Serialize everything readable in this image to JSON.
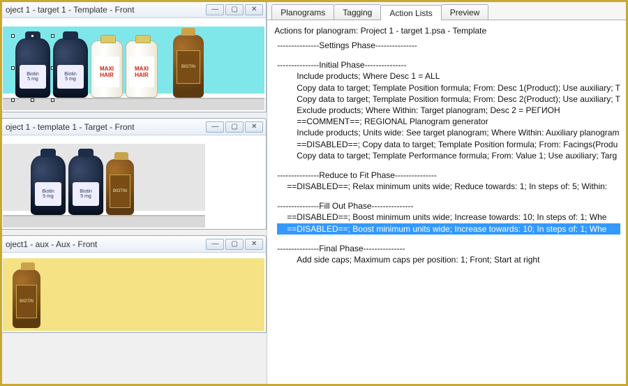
{
  "windows": {
    "w1": {
      "title": "oject 1 - target 1 - Template - Front"
    },
    "w2": {
      "title": "oject 1 - template 1 - Target - Front"
    },
    "w3": {
      "title": "oject1 - aux - Aux - Front"
    }
  },
  "products": {
    "biotin_label_line1": "Biotin",
    "biotin_label_line2": "5 mg",
    "maxihair_brand": "MAXI HAIR",
    "amber_label": "BIOTIN"
  },
  "tabs": {
    "t1": "Planograms",
    "t2": "Tagging",
    "t3": "Action Lists",
    "t4": "Preview"
  },
  "caption": "Actions for planogram: Project 1 - target 1.psa - Template",
  "lines": {
    "l01": "---------------Settings Phase---------------",
    "l02": "---------------Initial Phase---------------",
    "l03": "Include products;  Where   Desc 1 = ALL",
    "l04": "Copy data to target; Template Position formula; From: Desc 1(Product); Use auxiliary; T",
    "l05": "Copy data to target; Template Position formula; From: Desc 2(Product); Use auxiliary; T",
    "l06": "Exclude products; Where Within: Target planogram;   Desc 2 = РЕГИОН",
    "l07": "==COMMENT==; REGIONAL Planogram generator",
    "l08": "Include products; Units wide: See target planogram; Where Within: Auxiliary planogram",
    "l09": "==DISABLED==; Copy data to target; Template Position formula; From: Facings(Produ",
    "l10": "Copy data to target; Template Performance formula; From: Value 1; Use auxiliary; Targ",
    "l11": "---------------Reduce to Fit Phase---------------",
    "l12": "==DISABLED==; Relax minimum units wide; Reduce towards: 1; In steps of: 5; Within:",
    "l13": "---------------Fill Out Phase---------------",
    "l14": "==DISABLED==; Boost minimum units wide; Increase towards: 10; In steps of: 1; Whe",
    "l15": "==DISABLED==; Boost minimum units wide; Increase towards: 10; In steps of: 1; Whe",
    "l16": "---------------Final Phase---------------",
    "l17": "Add side caps; Maximum caps per position: 1; Front; Start at right"
  }
}
